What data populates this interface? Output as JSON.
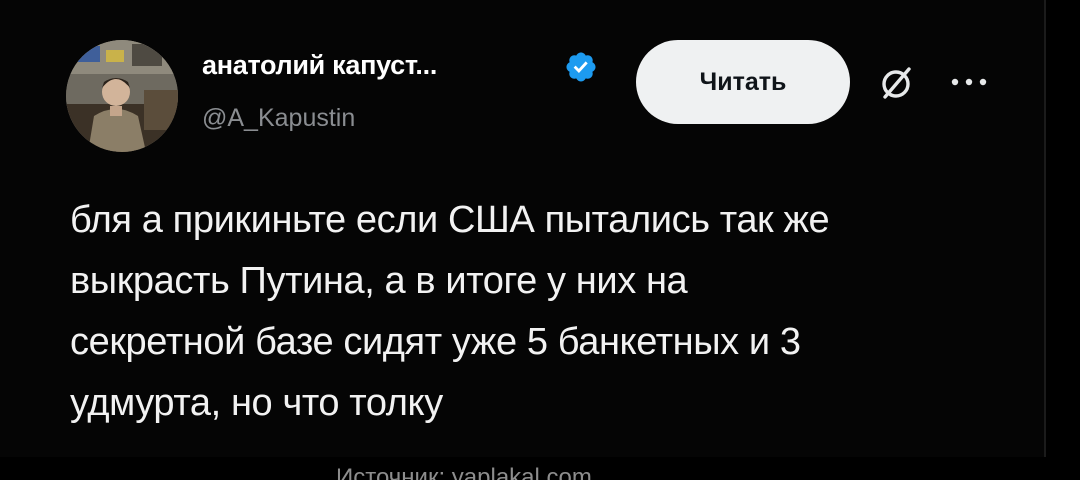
{
  "author": {
    "display_name": "анатолий капуст...",
    "handle": "@A_Kapustin",
    "verified": true
  },
  "header_actions": {
    "follow_label": "Читать",
    "grok_icon": "grok-icon",
    "more_icon": "more-icon"
  },
  "tweet": {
    "lines": [
      "бля а прикиньте если США пытались так же",
      "выкрасть Путина, а в итоге у них на",
      "секретной базе сидят уже 5 банкетных и 3",
      "удмурта, но что толку"
    ]
  },
  "watermark": {
    "text": "Источник: yaplakal.com"
  },
  "colors": {
    "background": "#000000",
    "verified_badge": "#1d9bf0",
    "follow_button": "#eff1f2",
    "handle_text": "#8a8d91"
  }
}
